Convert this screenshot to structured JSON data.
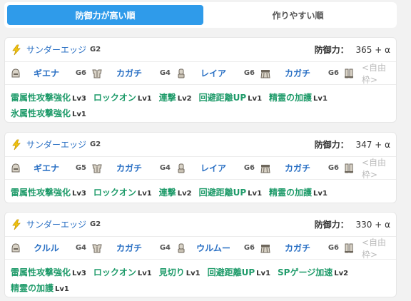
{
  "tabs": {
    "active": "防御力が高い順",
    "inactive": "作りやすい順"
  },
  "defense_label": "防御力：",
  "free_slot": "<自由枠>",
  "cards": [
    {
      "weapon": "サンダーエッジ",
      "weapon_grade": "G2",
      "defense": "365 + α",
      "armor": [
        {
          "name": "ギエナ",
          "level": "G6",
          "icon": "helmet-icon"
        },
        {
          "name": "カガチ",
          "level": "G4",
          "icon": "chest-icon"
        },
        {
          "name": "レイア",
          "level": "G6",
          "icon": "arm-icon"
        },
        {
          "name": "カガチ",
          "level": "G6",
          "icon": "waist-icon"
        }
      ],
      "skills": [
        {
          "name": "雷属性攻撃強化",
          "level": "Lv3"
        },
        {
          "name": "ロックオン",
          "level": "Lv1"
        },
        {
          "name": "連撃",
          "level": "Lv2"
        },
        {
          "name": "回避距離UP",
          "level": "Lv1"
        },
        {
          "name": "精霊の加護",
          "level": "Lv1"
        },
        {
          "name": "氷属性攻撃強化",
          "level": "Lv1"
        }
      ]
    },
    {
      "weapon": "サンダーエッジ",
      "weapon_grade": "G2",
      "defense": "347 + α",
      "armor": [
        {
          "name": "ギエナ",
          "level": "G5",
          "icon": "helmet-icon"
        },
        {
          "name": "カガチ",
          "level": "G4",
          "icon": "chest-icon"
        },
        {
          "name": "レイア",
          "level": "G6",
          "icon": "arm-icon"
        },
        {
          "name": "カガチ",
          "level": "G6",
          "icon": "waist-icon"
        }
      ],
      "skills": [
        {
          "name": "雷属性攻撃強化",
          "level": "Lv3"
        },
        {
          "name": "ロックオン",
          "level": "Lv1"
        },
        {
          "name": "連撃",
          "level": "Lv2"
        },
        {
          "name": "回避距離UP",
          "level": "Lv1"
        },
        {
          "name": "精霊の加護",
          "level": "Lv1"
        }
      ]
    },
    {
      "weapon": "サンダーエッジ",
      "weapon_grade": "G2",
      "defense": "330 + α",
      "armor": [
        {
          "name": "クルル",
          "level": "G4",
          "icon": "helmet-icon"
        },
        {
          "name": "カガチ",
          "level": "G4",
          "icon": "chest-icon"
        },
        {
          "name": "ウルムー",
          "level": "G6",
          "icon": "arm-icon"
        },
        {
          "name": "カガチ",
          "level": "G6",
          "icon": "waist-icon"
        }
      ],
      "skills": [
        {
          "name": "雷属性攻撃強化",
          "level": "Lv3"
        },
        {
          "name": "ロックオン",
          "level": "Lv1"
        },
        {
          "name": "見切り",
          "level": "Lv1"
        },
        {
          "name": "回避距離UP",
          "level": "Lv1"
        },
        {
          "name": "SPゲージ加速",
          "level": "Lv2"
        },
        {
          "name": "精霊の加護",
          "level": "Lv1"
        }
      ]
    }
  ]
}
